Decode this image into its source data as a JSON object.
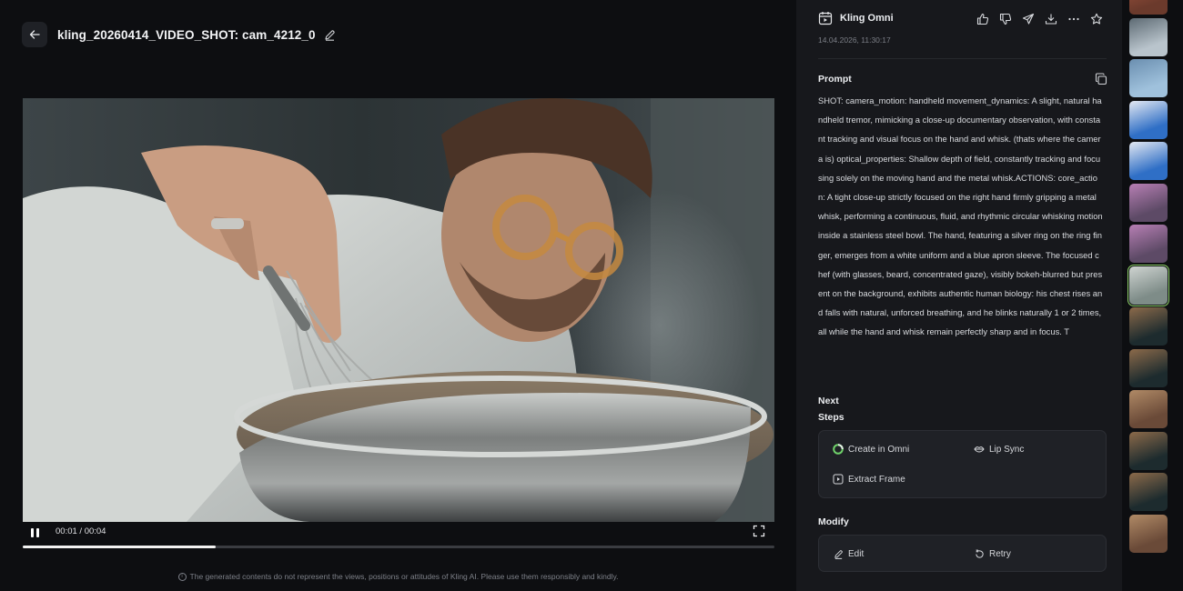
{
  "header": {
    "title": "kling_20260414_VIDEO_SHOT: cam_4212_0"
  },
  "player": {
    "time": "00:01 / 00:04",
    "progress_fraction": 0.257
  },
  "disclaimer": "The generated contents do not represent the views, positions or attitudes of Kling AI. Please use them responsibly and kindly.",
  "panel": {
    "model_name": "Kling Omni",
    "date": "14.04.2026, 11:30:17",
    "prompt_label": "Prompt",
    "prompt": "SHOT:  camera_motion: handheld  movement_dynamics: A slight, natural handheld tremor, mimicking a close-up documentary observation, with constant tracking and visual focus on the hand and whisk. (thats where the camera is)  optical_properties: Shallow depth of field, constantly tracking and focusing solely on the moving hand and the metal whisk.ACTIONS:  core_action: A tight close-up strictly focused on the right hand firmly gripping a metal whisk, performing a continuous, fluid, and rhythmic circular whisking motion inside a stainless steel bowl. The hand, featuring a silver ring on the ring finger, emerges from a white uniform and a blue apron sleeve. The focused chef (with glasses, beard, concentrated gaze), visibly bokeh-blurred but present on the background, exhibits authentic human biology: his chest rises and falls with natural, unforced breathing, and he blinks naturally 1 or 2 times, all while the hand and whisk remain perfectly sharp and in focus. T",
    "next_label": "Next",
    "steps_label": "Steps",
    "next_steps": {
      "create_omni": "Create in Omni",
      "lip_sync": "Lip Sync",
      "extract_frame": "Extract Frame"
    },
    "modify_label": "Modify",
    "modify": {
      "edit": "Edit",
      "retry": "Retry"
    }
  },
  "colors": {
    "panel_bg": "#17181c",
    "page_bg": "#0d0e11",
    "card_bg": "#1f2126",
    "active_thumb_outline": "#8fd16a",
    "omni_accent": "#6fd16a"
  },
  "thumbnails": [
    {
      "name": "thumb-red-strip"
    },
    {
      "name": "thumb-snowy-mountain"
    },
    {
      "name": "thumb-sky-jet"
    },
    {
      "name": "thumb-kotex-package-1"
    },
    {
      "name": "thumb-kotex-package-2"
    },
    {
      "name": "thumb-skier-face-1"
    },
    {
      "name": "thumb-skier-face-2"
    },
    {
      "name": "thumb-chef-whisk",
      "active": true
    },
    {
      "name": "thumb-dark-table-1"
    },
    {
      "name": "thumb-dark-table-2"
    },
    {
      "name": "thumb-bedroom-1"
    },
    {
      "name": "thumb-dark-table-3"
    },
    {
      "name": "thumb-dark-table-4"
    },
    {
      "name": "thumb-bedroom-2"
    }
  ]
}
